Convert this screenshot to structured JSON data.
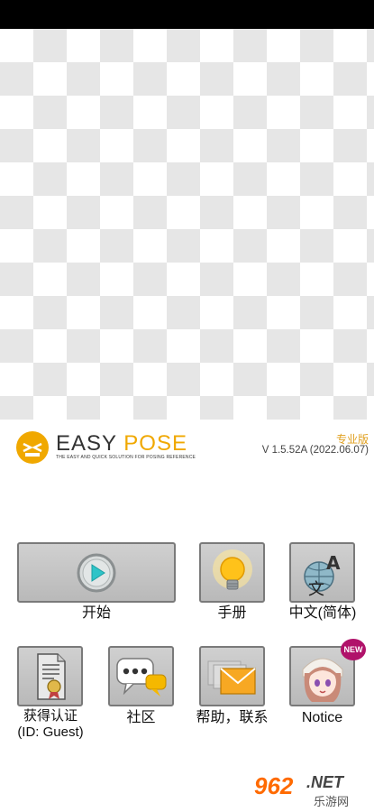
{
  "app": {
    "logo_word_1": "EASY",
    "logo_word_2": "POSE",
    "tagline": "THE EASY AND QUICK SOLUTION FOR POSING REFERENCE",
    "edition": "专业版",
    "version": "V 1.5.52A (2022.06.07)"
  },
  "menu": {
    "start": "开始",
    "manual": "手册",
    "language": "中文(简体)",
    "certify_line1": "获得认证",
    "certify_line2": "(ID: Guest)",
    "community": "社区",
    "help": "帮助，联系",
    "notice": "Notice",
    "new_badge": "NEW"
  },
  "watermark": {
    "brand": "962",
    "suffix": ".NET",
    "sub": "乐游网"
  },
  "colors": {
    "brand_orange": "#f0a800",
    "tile_bg": "#c4c4c4",
    "badge": "#b0126a"
  },
  "icons": [
    "play-icon",
    "lightbulb-icon",
    "language-globe-icon",
    "certificate-icon",
    "chat-bubbles-icon",
    "mail-icon",
    "notice-avatar-icon"
  ]
}
